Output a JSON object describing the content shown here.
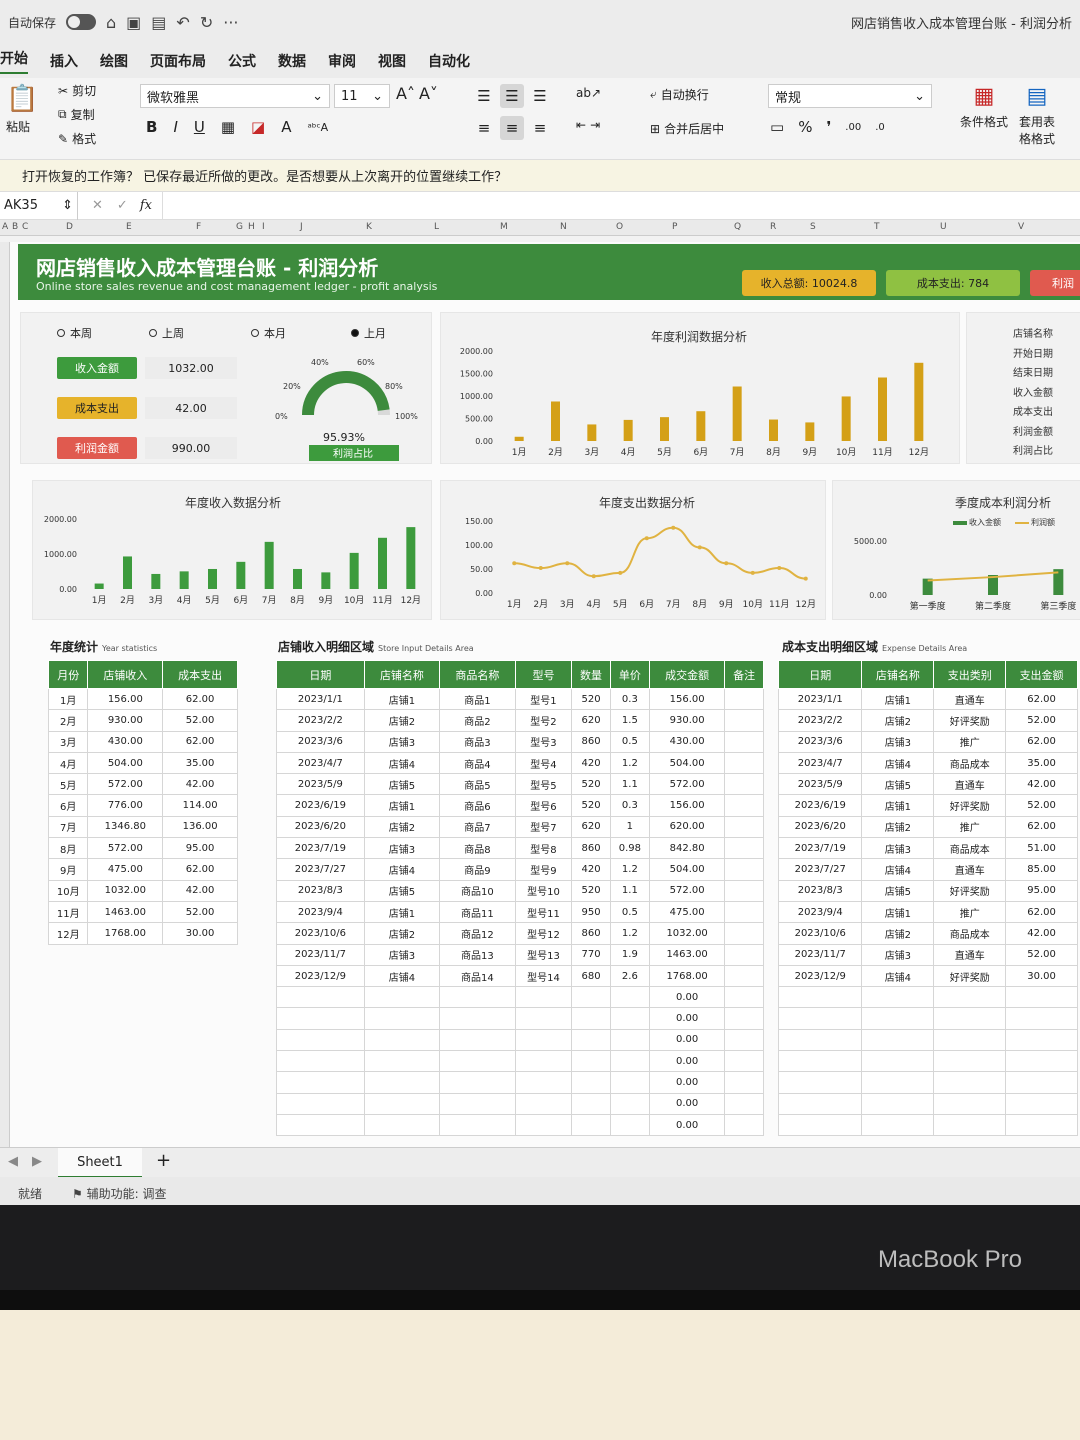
{
  "titlebar": {
    "autosave": "自动保存",
    "window_title": "网店销售收入成本管理台账 - 利润分析"
  },
  "menu": [
    "开始",
    "插入",
    "绘图",
    "页面布局",
    "公式",
    "数据",
    "审阅",
    "视图",
    "自动化"
  ],
  "ribbon": {
    "paste": "粘贴",
    "cut": "剪切",
    "copy": "复制",
    "format": "格式",
    "font": "微软雅黑",
    "size": "11",
    "wrap": "自动换行",
    "merge": "合并后居中",
    "numformat": "常规",
    "cond": "条件格式",
    "table_fmt": "套用表格格式"
  },
  "infobar": "打开恢复的工作簿？ 已保存最近所做的更改。是否想要从上次离开的位置继续工作？",
  "formula": {
    "cell": "AK35",
    "fx": "fx"
  },
  "colletters": [
    "A",
    "B",
    "C",
    "D",
    "E",
    "F",
    "G",
    "H",
    "I",
    "J",
    "K",
    "L",
    "M",
    "N",
    "O",
    "P",
    "Q",
    "R",
    "S",
    "T",
    "U",
    "V"
  ],
  "header": {
    "title": "网店销售收入成本管理台账 - 利润分析",
    "subtitle": "Online store sales revenue and cost management ledger - profit analysis",
    "total_income": "收入总额: 10024.8",
    "total_cost": "成本支出: 784",
    "profit_pill": "利润"
  },
  "kpi": {
    "radios": [
      "本周",
      "上周",
      "本月",
      "上月"
    ],
    "labels": [
      "收入金额",
      "成本支出",
      "利润金额"
    ],
    "values": [
      "1032.00",
      "42.00",
      "990.00"
    ],
    "gauge_ticks": [
      "0%",
      "20%",
      "40%",
      "60%",
      "80%",
      "100%"
    ],
    "gauge_value": "95.93%",
    "gauge_label": "利润占比",
    "gauge_fraction": 0.9593
  },
  "right_list": [
    "店铺名称",
    "开始日期",
    "结束日期",
    "收入金额",
    "成本支出",
    "利润金额",
    "利润占比"
  ],
  "chart_data": [
    {
      "type": "bar",
      "title": "年度利润数据分析",
      "categories": [
        "1月",
        "2月",
        "3月",
        "4月",
        "5月",
        "6月",
        "7月",
        "8月",
        "9月",
        "10月",
        "11月",
        "12月"
      ],
      "values": [
        94,
        878,
        368,
        469,
        530,
        662,
        1211,
        477,
        413,
        990,
        1411,
        1738
      ],
      "yticks": [
        "0.00",
        "500.00",
        "1000.00",
        "1500.00",
        "2000.00"
      ],
      "ylim": [
        0,
        2000
      ],
      "color": "#d4a017"
    },
    {
      "type": "bar",
      "title": "年度收入数据分析",
      "categories": [
        "1月",
        "2月",
        "3月",
        "4月",
        "5月",
        "6月",
        "7月",
        "8月",
        "9月",
        "10月",
        "11月",
        "12月"
      ],
      "values": [
        156,
        930,
        430,
        504,
        572,
        776,
        1346.8,
        572,
        475,
        1032,
        1463,
        1768
      ],
      "yticks": [
        "0.00",
        "1000.00",
        "2000.00"
      ],
      "ylim": [
        0,
        2000
      ],
      "color": "#3d9b3d"
    },
    {
      "type": "line",
      "title": "年度支出数据分析",
      "categories": [
        "1月",
        "2月",
        "3月",
        "4月",
        "5月",
        "6月",
        "7月",
        "8月",
        "9月",
        "10月",
        "11月",
        "12月"
      ],
      "values": [
        62,
        52,
        62,
        35,
        42,
        114,
        136,
        95,
        62,
        42,
        52,
        30
      ],
      "yticks": [
        "0.00",
        "50.00",
        "100.00",
        "150.00"
      ],
      "ylim": [
        0,
        150
      ],
      "color": "#e0b341"
    },
    {
      "type": "bar",
      "title": "季度成本利润分析",
      "categories": [
        "第一季度",
        "第二季度",
        "第三季度"
      ],
      "series": [
        {
          "name": "收入金额",
          "values": [
            1516,
            1852,
            2393.8
          ]
        },
        {
          "name": "利润额",
          "values": [
            1340,
            1661,
            2100
          ]
        }
      ],
      "yticks": [
        "0.00",
        "5000.00"
      ],
      "ylim": [
        0,
        5000
      ],
      "legend": "top-right"
    }
  ],
  "year_stats": {
    "title": "年度统计",
    "sub": "Year statistics",
    "headers": [
      "月份",
      "店铺收入",
      "成本支出"
    ],
    "rows": [
      [
        "1月",
        "156.00",
        "62.00"
      ],
      [
        "2月",
        "930.00",
        "52.00"
      ],
      [
        "3月",
        "430.00",
        "62.00"
      ],
      [
        "4月",
        "504.00",
        "35.00"
      ],
      [
        "5月",
        "572.00",
        "42.00"
      ],
      [
        "6月",
        "776.00",
        "114.00"
      ],
      [
        "7月",
        "1346.80",
        "136.00"
      ],
      [
        "8月",
        "572.00",
        "95.00"
      ],
      [
        "9月",
        "475.00",
        "62.00"
      ],
      [
        "10月",
        "1032.00",
        "42.00"
      ],
      [
        "11月",
        "1463.00",
        "52.00"
      ],
      [
        "12月",
        "1768.00",
        "30.00"
      ]
    ]
  },
  "income": {
    "title": "店铺收入明细区域",
    "sub": "Store Input Details Area",
    "headers": [
      "日期",
      "店铺名称",
      "商品名称",
      "型号",
      "数量",
      "单价",
      "成交金额",
      "备注"
    ],
    "rows": [
      [
        "2023/1/1",
        "店铺1",
        "商品1",
        "型号1",
        "520",
        "0.3",
        "156.00",
        ""
      ],
      [
        "2023/2/2",
        "店铺2",
        "商品2",
        "型号2",
        "620",
        "1.5",
        "930.00",
        ""
      ],
      [
        "2023/3/6",
        "店铺3",
        "商品3",
        "型号3",
        "860",
        "0.5",
        "430.00",
        ""
      ],
      [
        "2023/4/7",
        "店铺4",
        "商品4",
        "型号4",
        "420",
        "1.2",
        "504.00",
        ""
      ],
      [
        "2023/5/9",
        "店铺5",
        "商品5",
        "型号5",
        "520",
        "1.1",
        "572.00",
        ""
      ],
      [
        "2023/6/19",
        "店铺1",
        "商品6",
        "型号6",
        "520",
        "0.3",
        "156.00",
        ""
      ],
      [
        "2023/6/20",
        "店铺2",
        "商品7",
        "型号7",
        "620",
        "1",
        "620.00",
        ""
      ],
      [
        "2023/7/19",
        "店铺3",
        "商品8",
        "型号8",
        "860",
        "0.98",
        "842.80",
        ""
      ],
      [
        "2023/7/27",
        "店铺4",
        "商品9",
        "型号9",
        "420",
        "1.2",
        "504.00",
        ""
      ],
      [
        "2023/8/3",
        "店铺5",
        "商品10",
        "型号10",
        "520",
        "1.1",
        "572.00",
        ""
      ],
      [
        "2023/9/4",
        "店铺1",
        "商品11",
        "型号11",
        "950",
        "0.5",
        "475.00",
        ""
      ],
      [
        "2023/10/6",
        "店铺2",
        "商品12",
        "型号12",
        "860",
        "1.2",
        "1032.00",
        ""
      ],
      [
        "2023/11/7",
        "店铺3",
        "商品13",
        "型号13",
        "770",
        "1.9",
        "1463.00",
        ""
      ],
      [
        "2023/12/9",
        "店铺4",
        "商品14",
        "型号14",
        "680",
        "2.6",
        "1768.00",
        ""
      ],
      [
        "",
        "",
        "",
        "",
        "",
        "",
        "0.00",
        ""
      ],
      [
        "",
        "",
        "",
        "",
        "",
        "",
        "0.00",
        ""
      ],
      [
        "",
        "",
        "",
        "",
        "",
        "",
        "0.00",
        ""
      ],
      [
        "",
        "",
        "",
        "",
        "",
        "",
        "0.00",
        ""
      ],
      [
        "",
        "",
        "",
        "",
        "",
        "",
        "0.00",
        ""
      ],
      [
        "",
        "",
        "",
        "",
        "",
        "",
        "0.00",
        ""
      ],
      [
        "",
        "",
        "",
        "",
        "",
        "",
        "0.00",
        ""
      ]
    ]
  },
  "expense": {
    "title": "成本支出明细区域",
    "sub": "Expense Details Area",
    "headers": [
      "日期",
      "店铺名称",
      "支出类别",
      "支出金额"
    ],
    "rows": [
      [
        "2023/1/1",
        "店铺1",
        "直通车",
        "62.00"
      ],
      [
        "2023/2/2",
        "店铺2",
        "好评奖励",
        "52.00"
      ],
      [
        "2023/3/6",
        "店铺3",
        "推广",
        "62.00"
      ],
      [
        "2023/4/7",
        "店铺4",
        "商品成本",
        "35.00"
      ],
      [
        "2023/5/9",
        "店铺5",
        "直通车",
        "42.00"
      ],
      [
        "2023/6/19",
        "店铺1",
        "好评奖励",
        "52.00"
      ],
      [
        "2023/6/20",
        "店铺2",
        "推广",
        "62.00"
      ],
      [
        "2023/7/19",
        "店铺3",
        "商品成本",
        "51.00"
      ],
      [
        "2023/7/27",
        "店铺4",
        "直通车",
        "85.00"
      ],
      [
        "2023/8/3",
        "店铺5",
        "好评奖励",
        "95.00"
      ],
      [
        "2023/9/4",
        "店铺1",
        "推广",
        "62.00"
      ],
      [
        "2023/10/6",
        "店铺2",
        "商品成本",
        "42.00"
      ],
      [
        "2023/11/7",
        "店铺3",
        "直通车",
        "52.00"
      ],
      [
        "2023/12/9",
        "店铺4",
        "好评奖励",
        "30.00"
      ],
      [
        "",
        "",
        "",
        ""
      ],
      [
        "",
        "",
        "",
        ""
      ],
      [
        "",
        "",
        "",
        ""
      ],
      [
        "",
        "",
        "",
        ""
      ],
      [
        "",
        "",
        "",
        ""
      ],
      [
        "",
        "",
        "",
        ""
      ],
      [
        "",
        "",
        "",
        ""
      ]
    ]
  },
  "tabs": {
    "sheet": "Sheet1",
    "add": "+"
  },
  "status": {
    "ready": "就绪",
    "access": "辅助功能: 调查"
  },
  "device": "MacBook Pro",
  "colors": {
    "green": "#3d8b3d",
    "gold": "#d4a017",
    "red": "#d9534f"
  }
}
